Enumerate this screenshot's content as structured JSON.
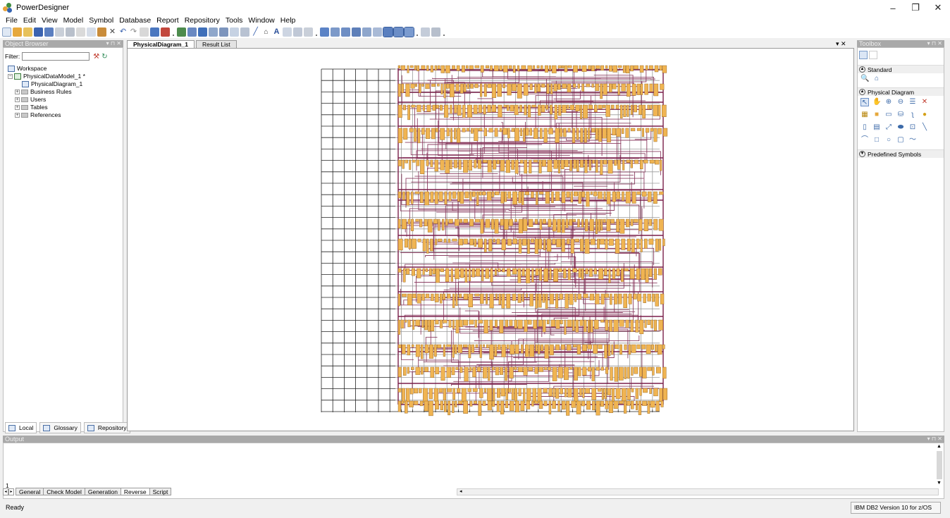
{
  "window": {
    "title": "PowerDesigner",
    "controls": {
      "minimize": "–",
      "restore": "❐",
      "close": "✕"
    }
  },
  "menu": [
    "File",
    "Edit",
    "View",
    "Model",
    "Symbol",
    "Database",
    "Report",
    "Repository",
    "Tools",
    "Window",
    "Help"
  ],
  "object_browser": {
    "title": "Object Browser",
    "filter_label": "Filter:",
    "filter_value": "",
    "tree": [
      {
        "label": "Workspace",
        "level": 0,
        "icon": "workspace-icon"
      },
      {
        "label": "PhysicalDataModel_1 *",
        "level": 1,
        "icon": "model-icon",
        "expander": "−"
      },
      {
        "label": "PhysicalDiagram_1",
        "level": 2,
        "icon": "diagram-icon"
      },
      {
        "label": "Business Rules",
        "level": 2,
        "icon": "folder-icon",
        "expander": "+"
      },
      {
        "label": "Users",
        "level": 2,
        "icon": "folder-icon",
        "expander": "+"
      },
      {
        "label": "Tables",
        "level": 2,
        "icon": "folder-icon",
        "expander": "+"
      },
      {
        "label": "References",
        "level": 2,
        "icon": "folder-icon",
        "expander": "+"
      }
    ],
    "bottom_tabs": [
      "Local",
      "Glossary",
      "Repository"
    ]
  },
  "document_tabs": [
    {
      "label": "PhysicalDiagram_1",
      "active": true
    },
    {
      "label": "Result List",
      "active": false
    }
  ],
  "document_controls": "▾ ✕",
  "toolbox": {
    "title": "Toolbox",
    "sections": [
      {
        "label": "Standard",
        "state": "expanded"
      },
      {
        "label": "Physical Diagram",
        "state": "expanded"
      },
      {
        "label": "Predefined Symbols",
        "state": "collapsed"
      }
    ]
  },
  "output": {
    "title": "Output",
    "line": "1",
    "tabs": [
      "General",
      "Check Model",
      "Generation",
      "Reverse",
      "Script"
    ],
    "active_tab": "Reverse"
  },
  "status": {
    "text": "Ready",
    "dbms": "IBM DB2 Version 10 for z/OS"
  },
  "colors": {
    "table_fill": "#f0b452",
    "reference_line": "#7a1f4a",
    "grid_line": "#222222",
    "panel_header": "#a9a9a9"
  }
}
